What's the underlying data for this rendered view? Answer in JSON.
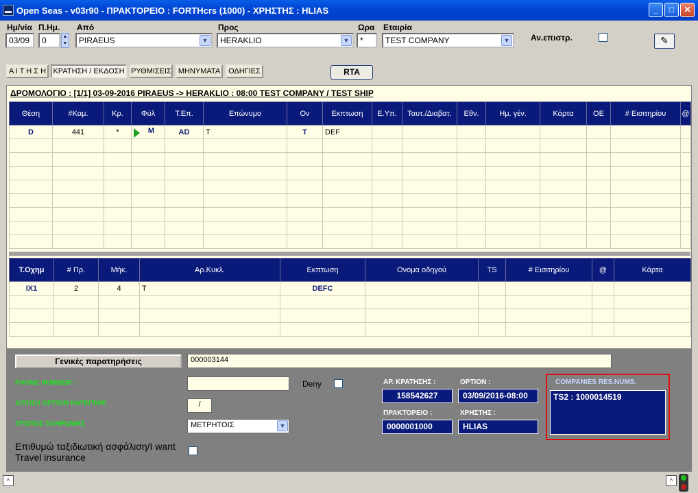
{
  "window": {
    "title": "Open Seas  - v03r90 - ΠΡΑΚΤΟΡΕΙΟ : FORTHcrs (1000) - ΧΡΗΣΤΗΣ : HLIAS",
    "minimize": "_",
    "maximize": "□",
    "close": "✕"
  },
  "header": {
    "date_label": "Ημ/νία",
    "date_value": "03/09",
    "days_label": "Π.Ημ.",
    "days_value": "0",
    "from_label": "Από",
    "from_value": "PIRAEUS",
    "to_label": "Προς",
    "to_value": "HERAKLIO",
    "time_label": "Ωρα",
    "time_value": "*",
    "company_label": "Εταιρία",
    "company_value": "TEST COMPANY",
    "return_label": "Αν.επιστρ."
  },
  "tabs": [
    {
      "label": "Α Ι Τ Η Σ Η"
    },
    {
      "label": "ΚΡΑΤΗΣΗ / ΕΚΔΟΣΗ"
    },
    {
      "label": "ΡΥΘΜΙΣΕΙΣ"
    },
    {
      "label": "ΜΗΝΥΜΑΤΑ"
    },
    {
      "label": "ΟΔΗΓΙΕΣ"
    }
  ],
  "rta_label": "RTA",
  "route": "ΔΡΟΜΟΛΟΓΙΟ : [1/1]  03-09-2016    PIRAEUS -> HERAKLIO : 08:00    TEST COMPANY  /  TEST SHIP",
  "passengers": {
    "columns": [
      "Θέση",
      "#Καμ.",
      "Κρ.",
      "Φύλ",
      "Τ.Επ.",
      "Επώνυμο",
      "Ον",
      "Εκπτωση",
      "Ε.Υπ.",
      "Ταυτ./Διαβατ.",
      "Εθν.",
      "Ημ. γέν.",
      "Κάρτα",
      "ΟΕ",
      "# Εισιτηρίου",
      "@"
    ],
    "rows": [
      [
        "D",
        "441",
        "*",
        "M",
        "AD",
        "T",
        "T",
        "DEF",
        "",
        "",
        "",
        "",
        "",
        "",
        "",
        ""
      ]
    ],
    "empty_rows": 8
  },
  "vehicles": {
    "columns": [
      "Τ.Οχημ",
      "# Πρ.",
      "Μήκ.",
      "Αρ.Κυκλ.",
      "Εκπτωση",
      "Ονομα οδηγού",
      "TS",
      "# Εισιτηρίου",
      "@",
      "Κάρτα"
    ],
    "rows": [
      [
        "IX1",
        "2",
        "4",
        "T",
        "DEFC",
        "",
        "",
        "",
        "",
        ""
      ]
    ],
    "empty_rows": 3
  },
  "bottom": {
    "general_notes_label": "Γενικές παρατηρήσεις",
    "general_notes_value": "000003144",
    "phone_label": "PHONE NUMBER :",
    "phone_value": "",
    "deny_label": "Deny",
    "option_date_label": "ΑΙΤΗΣΗ OPTION DATE/TIME",
    "option_date_value": "/",
    "payment_label": "ΤΡΟΠΟΣ ΠΛΗΡΩΜΗΣ",
    "payment_value": "ΜΕΤΡΗΤΟΙΣ",
    "insurance_label_1": "Επιθυμώ ταξιδιωτική ασφάλιση/I want",
    "insurance_label_2": "Travel insurance",
    "booking_no_label": "ΑΡ. ΚΡΑΤΗΣΗΣ :",
    "booking_no_value": "158542627",
    "option_label": "OPTION :",
    "option_value": "03/09/2016-08:00",
    "agency_label": "ΠΡΑΚΤΟΡΕΙΟ :",
    "agency_value": "0000001000",
    "user_label": "ΧΡΗΣΤΗΣ :",
    "user_value": "HLIAS",
    "companies_label": "COMPANIES RES.NUMS.",
    "companies_value": "TS2  : 1000014519"
  },
  "colors": {
    "header_navy": "#0a1a7a",
    "grid_bg": "#fffde6",
    "bottom_bg": "#808080",
    "green_label": "#20e020",
    "highlight_border": "#e01010"
  }
}
